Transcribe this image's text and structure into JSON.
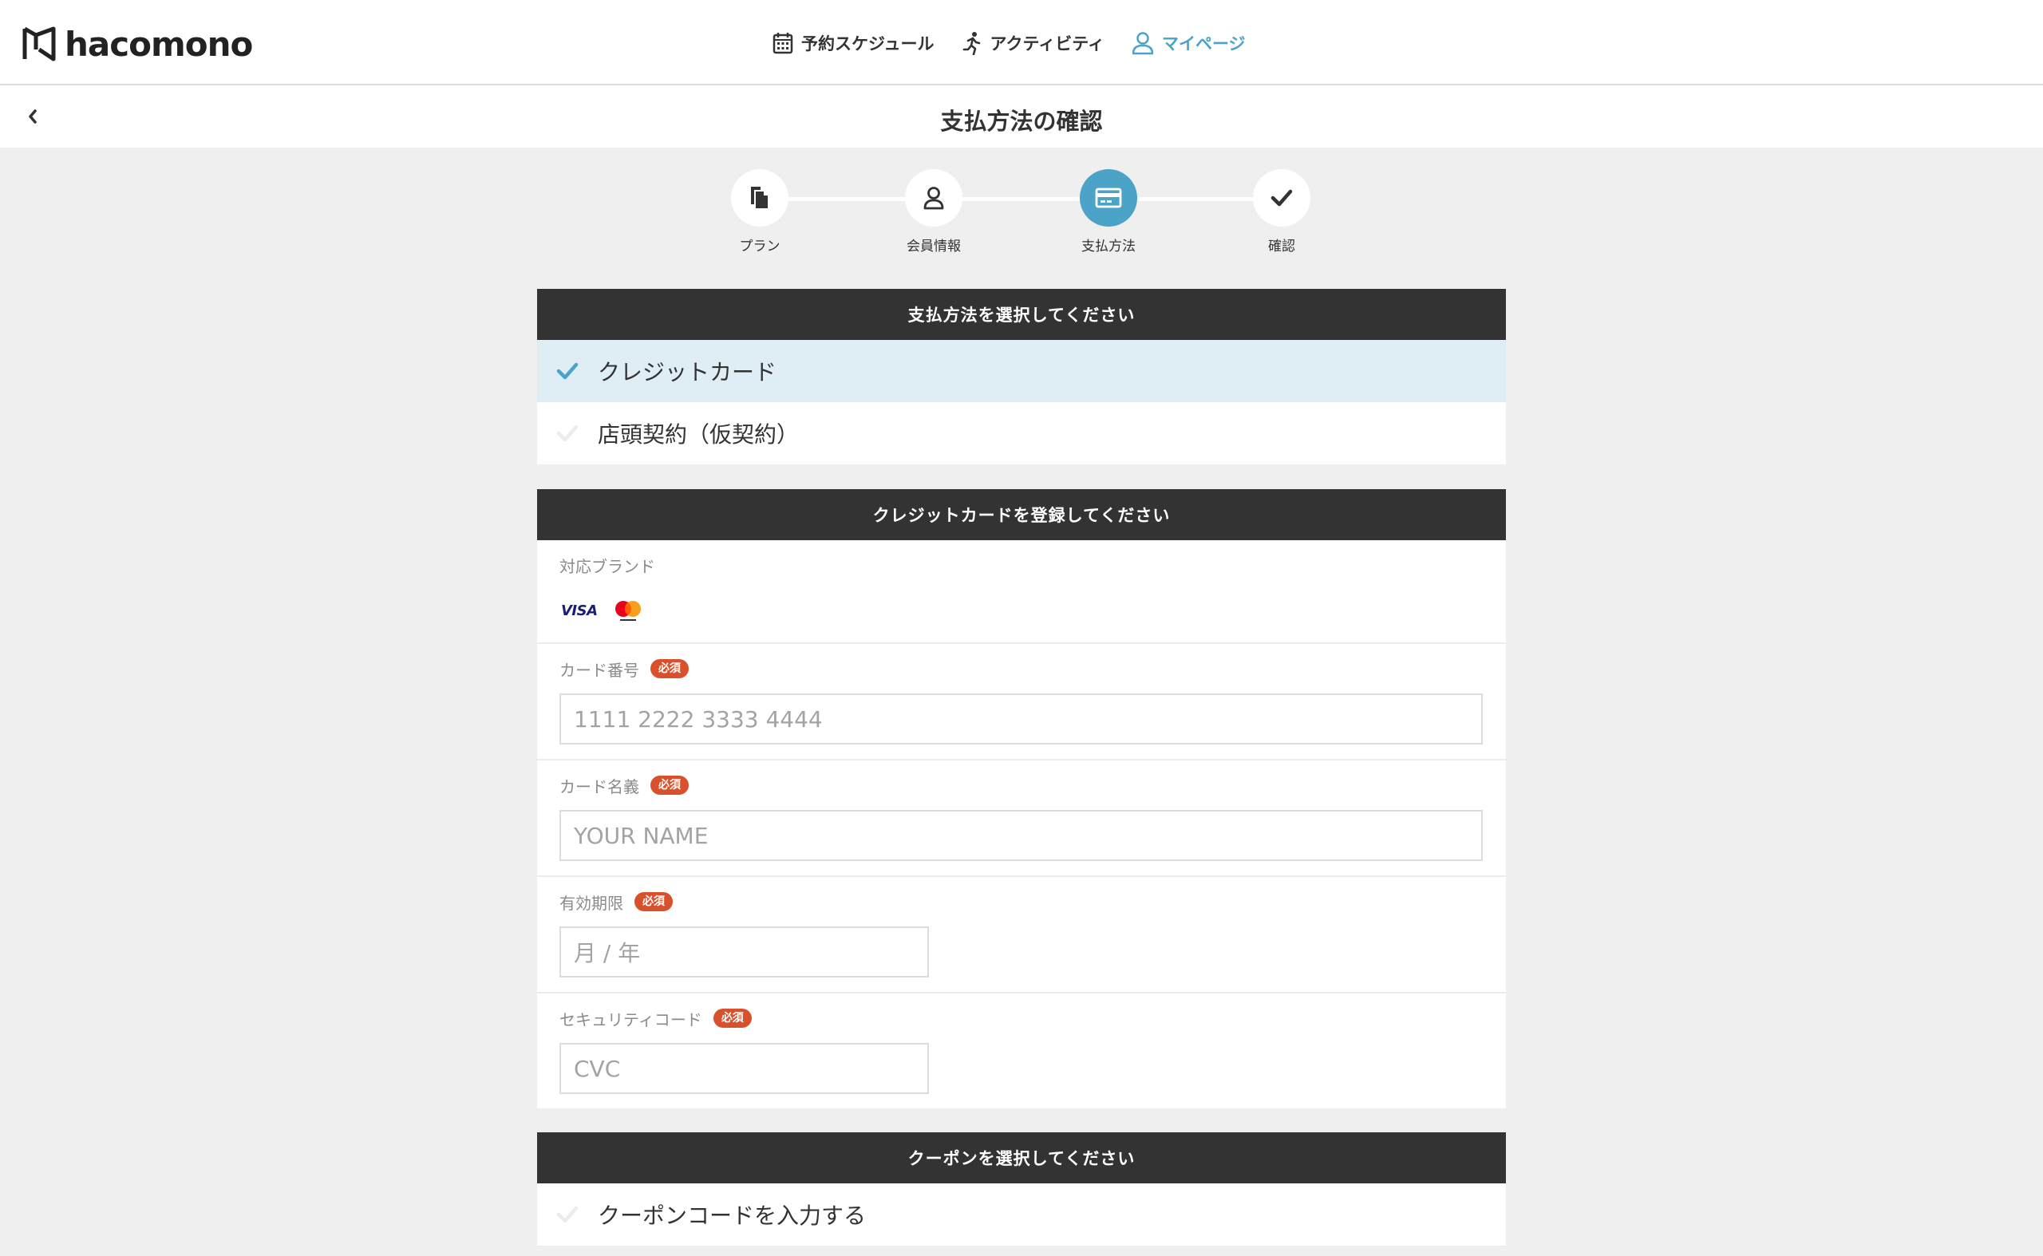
{
  "header": {
    "logo_text": "hacomono",
    "nav": [
      {
        "label": "予約スケジュール",
        "icon": "calendar-icon"
      },
      {
        "label": "アクティビティ",
        "icon": "running-icon"
      },
      {
        "label": "マイページ",
        "icon": "user-icon",
        "active": true
      }
    ]
  },
  "page": {
    "title": "支払方法の確認"
  },
  "steps": [
    {
      "label": "プラン",
      "icon": "documents-icon"
    },
    {
      "label": "会員情報",
      "icon": "user-icon"
    },
    {
      "label": "支払方法",
      "icon": "credit-card-icon",
      "current": true
    },
    {
      "label": "確認",
      "icon": "checkmark-icon"
    }
  ],
  "payment": {
    "heading": "支払方法を選択してください",
    "options": [
      {
        "label": "クレジットカード",
        "selected": true
      },
      {
        "label": "店頭契約（仮契約）",
        "selected": false
      }
    ]
  },
  "card": {
    "heading": "クレジットカードを登録してください",
    "brands_label": "対応ブランド",
    "brands": [
      "VISA",
      "Mastercard"
    ],
    "required_badge": "必須",
    "fields": {
      "number": {
        "label": "カード番号",
        "placeholder": "1111 2222 3333 4444"
      },
      "name": {
        "label": "カード名義",
        "placeholder": "YOUR NAME"
      },
      "expiry": {
        "label": "有効期限",
        "placeholder": "月 / 年"
      },
      "cvc": {
        "label": "セキュリティコード",
        "placeholder": "CVC"
      }
    }
  },
  "coupon": {
    "heading": "クーポンを選択してください",
    "option": "クーポンコードを入力する"
  },
  "colors": {
    "accent": "#4ba3c7",
    "section_header": "#333333",
    "selected_row": "#dfeef5",
    "required_badge": "#d9502c",
    "background": "#efefef"
  }
}
